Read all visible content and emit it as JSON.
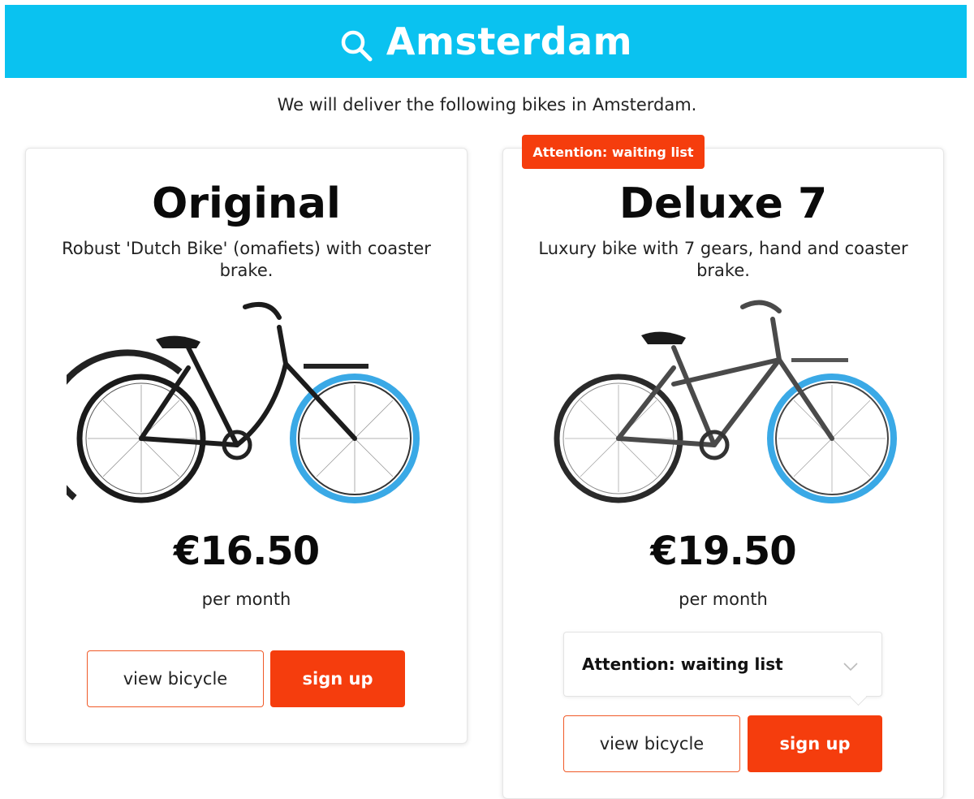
{
  "colors": {
    "header_bg": "#0ac2f0",
    "accent": "#f53d0d",
    "bike_tire": "#3aa9e6"
  },
  "header": {
    "title": "Amsterdam",
    "icon": "search-icon"
  },
  "intro_text": "We will deliver the following bikes in Amsterdam.",
  "products": [
    {
      "title": "Original",
      "description": "Robust 'Dutch Bike' (omafiets) with coaster brake.",
      "price": "€16.50",
      "period": "per month",
      "view_label": "view bicycle",
      "signup_label": "sign up"
    },
    {
      "title": "Deluxe 7",
      "ribbon": "Attention: waiting list",
      "description": "Luxury bike with 7 gears, hand and coaster brake.",
      "price": "€19.50",
      "period": "per month",
      "select_value": "Attention: waiting list",
      "view_label": "view bicycle",
      "signup_label": "sign up"
    }
  ]
}
